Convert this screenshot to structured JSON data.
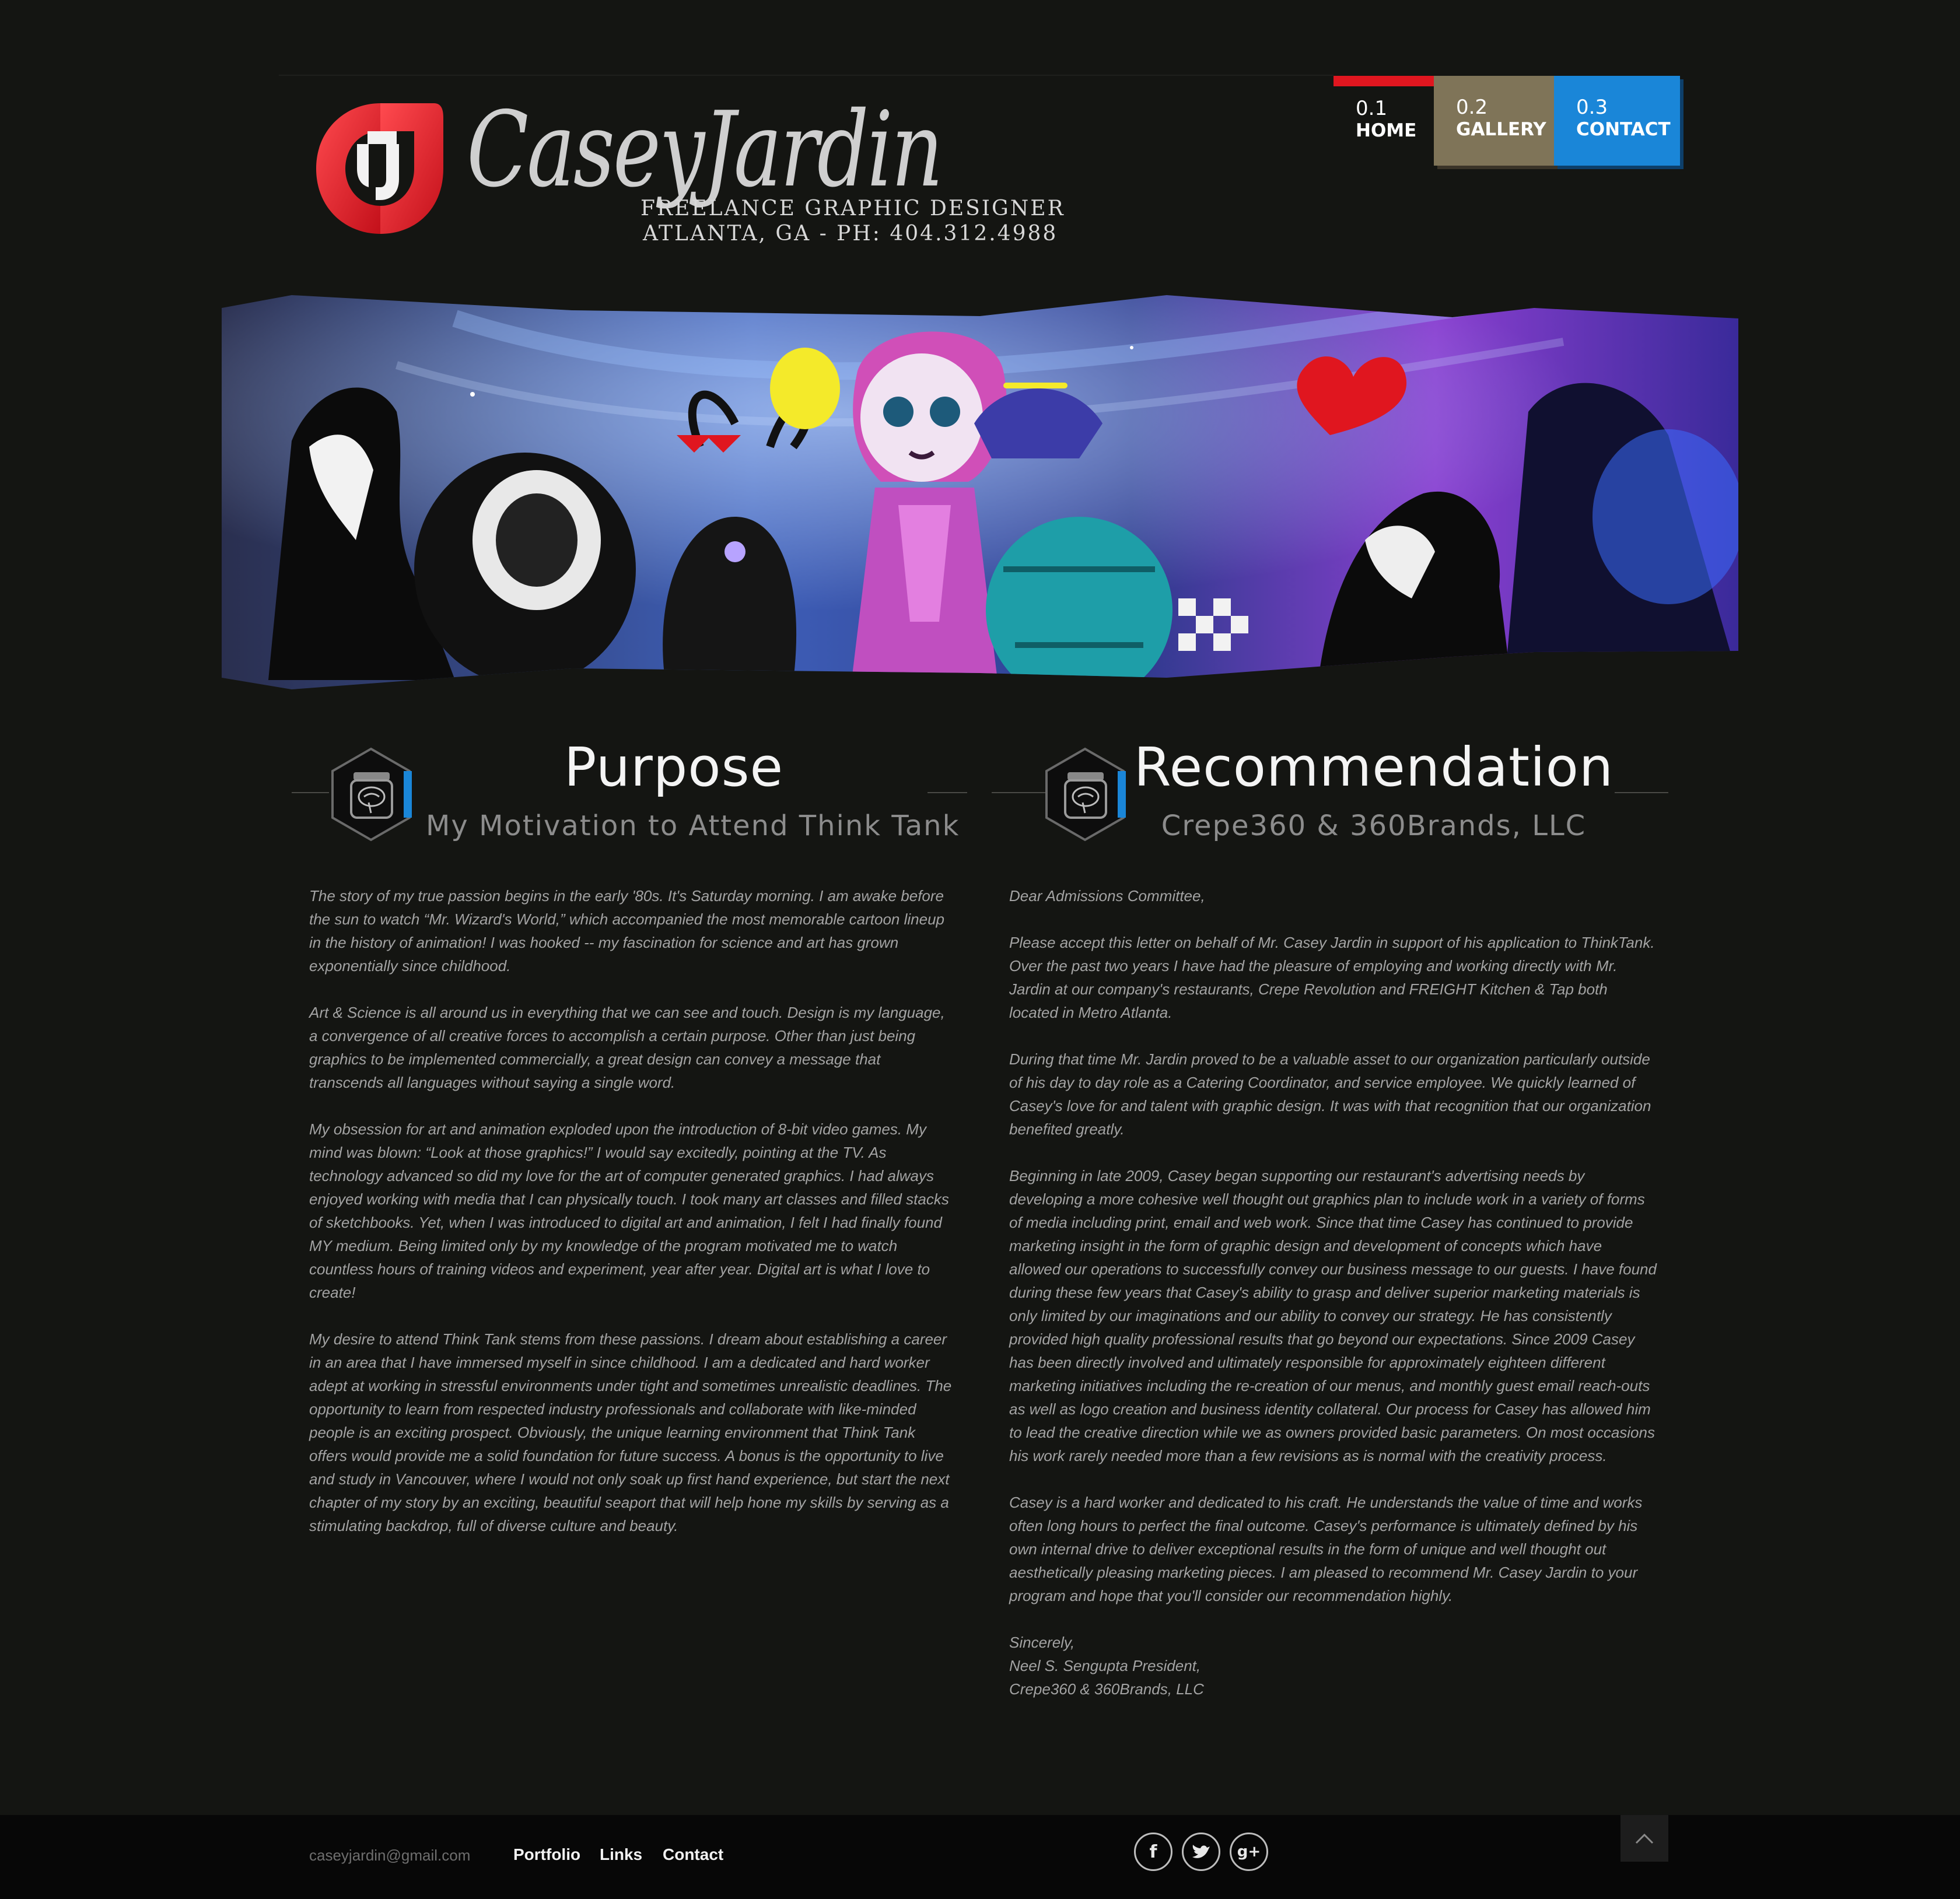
{
  "logo": {
    "name": "CaseyJardin",
    "tagline": "FREELANCE GRAPHIC DESIGNER",
    "location": "ATLANTA, GA  - PH: 404.312.4988"
  },
  "nav": [
    {
      "num": "0.1",
      "label": "HOME"
    },
    {
      "num": "0.2",
      "label": "GALLERY"
    },
    {
      "num": "0.3",
      "label": "CONTACT"
    }
  ],
  "colors": {
    "background": "#141512",
    "home_accent": "#e0161f",
    "gallery": "#7f7458",
    "contact": "#1a86d8",
    "footer": "#070707"
  },
  "purpose": {
    "title": "Purpose",
    "subtitle": "My Motivation to Attend Think Tank",
    "icon": "brain-jar-icon",
    "paragraphs": [
      "The story of my true passion begins in the early '80s. It's Saturday morning. I am awake before the sun to watch “Mr. Wizard's World,” which accompanied the most memorable cartoon lineup in the history of animation! I was hooked -- my fascination for science and art has grown exponentially since childhood.",
      "Art & Science is all around us in everything that we can see and touch. Design is my language, a convergence of all creative forces to accomplish a certain purpose. Other than just being graphics to be implemented commercially, a great design can convey a message that transcends all languages without saying a single word.",
      "My obsession for art and animation exploded upon the introduction of 8-bit video games. My mind was blown: “Look at those graphics!” I would say excitedly, pointing at the TV. As technology advanced so did my love for the art of computer generated graphics. I had always enjoyed working with media that I can physically touch. I took many art classes and filled stacks of sketchbooks. Yet, when I was introduced to digital art and animation, I felt I had finally found MY medium. Being limited only by my knowledge of the program motivated me to watch countless hours of training videos and experiment, year after year. Digital art is what I love to create!",
      "My desire to attend Think Tank stems from these passions. I dream about establishing a career in an area that I have immersed myself in since childhood. I am a dedicated and hard worker adept at working in stressful environments under tight and sometimes unrealistic deadlines. The opportunity to learn from respected industry professionals and collaborate with like-minded people is an exciting prospect. Obviously, the unique learning environment that Think Tank offers would provide me a solid foundation for future success. A bonus is the opportunity to live and study in Vancouver, where I would not only soak up first hand experience, but start the next chapter of my story by an exciting, beautiful seaport that will help hone my skills by serving as a stimulating backdrop, full of diverse culture and beauty."
    ]
  },
  "recommendation": {
    "title": "Recommendation",
    "subtitle": "Crepe360 & 360Brands, LLC",
    "icon": "brain-jar-icon",
    "greeting": "Dear Admissions Committee,",
    "paragraphs": [
      "Please accept this letter on behalf of Mr. Casey Jardin in support of his application to ThinkTank. Over the past two years I have had the pleasure of employing and working directly with Mr. Jardin at our company's restaurants, Crepe Revolution and FREIGHT Kitchen & Tap both located in Metro Atlanta.",
      "During that time Mr. Jardin proved to be a valuable asset to our organization particularly outside of his day to day role as a Catering Coordinator, and service employee. We quickly learned of Casey's love for and talent with graphic design. It was with that recognition that our organization benefited greatly.",
      "Beginning in late 2009, Casey began supporting our restaurant's advertising needs by developing a more cohesive well thought out graphics plan to include work in a variety of forms of media including print, email and web work. Since that time Casey has continued to provide marketing insight in the form of graphic design and development of concepts which have allowed our operations to successfully convey our business message to our guests. I have found during these few years that Casey's ability to grasp and deliver superior marketing materials is only limited by our imaginations and our ability to convey our strategy. He has consistently provided high quality professional results that go beyond our expectations. Since 2009 Casey has been directly involved and ultimately responsible for approximately eighteen different marketing initiatives including the re-creation of our menus, and monthly guest email reach-outs as well as logo creation and business identity collateral. Our process for Casey has allowed him to lead the creative direction while we as owners provided basic parameters. On most occasions his work rarely needed more than a few revisions as is normal with the creativity process.",
      "Casey is a hard worker and dedicated to his craft. He understands the value of time and works often long hours to perfect the final outcome. Casey's performance is ultimately defined by his own internal drive to deliver exceptional results in the form of unique and well thought out aesthetically pleasing marketing pieces. I am pleased to recommend Mr. Casey Jardin to your program and hope that you'll consider our recommendation highly."
    ],
    "closing": "Sincerely,",
    "signer": "Neel S. Sengupta President,",
    "company": "Crepe360 & 360Brands, LLC"
  },
  "footer": {
    "email": "caseyjardin@gmail.com",
    "links": [
      "Portfolio",
      "Links",
      "Contact"
    ],
    "social": [
      "facebook-icon",
      "twitter-icon",
      "google-plus-icon"
    ],
    "facebook_glyph": "f",
    "google_glyph": "g+",
    "back_to_top_icon": "chevron-up-icon"
  }
}
